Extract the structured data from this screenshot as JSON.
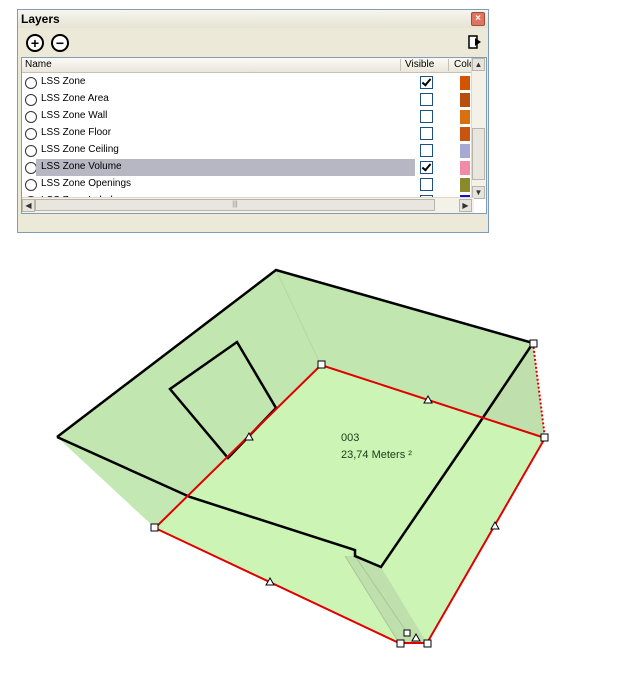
{
  "panel": {
    "title": "Layers",
    "close_glyph": "×",
    "add_glyph": "+",
    "remove_glyph": "−",
    "columns": {
      "name": "Name",
      "visible": "Visible",
      "color": "Colo"
    },
    "rows": [
      {
        "name": "LSS Zone",
        "visible": true,
        "color": "#d35400",
        "selected": false
      },
      {
        "name": "LSS Zone Area",
        "visible": false,
        "color": "#b94d0e",
        "selected": false
      },
      {
        "name": "LSS Zone Wall",
        "visible": false,
        "color": "#d9700f",
        "selected": false
      },
      {
        "name": "LSS Zone Floor",
        "visible": false,
        "color": "#c9530f",
        "selected": false
      },
      {
        "name": "LSS Zone Ceiling",
        "visible": false,
        "color": "#a6a9d2",
        "selected": false
      },
      {
        "name": "LSS Zone Volume",
        "visible": true,
        "color": "#f08ca8",
        "selected": true
      },
      {
        "name": "LSS Zone Openings",
        "visible": false,
        "color": "#8a8a2a",
        "selected": false
      },
      {
        "name": "LSS Zone Label",
        "visible": true,
        "color": "#1010d0",
        "selected": false
      }
    ]
  },
  "zone": {
    "number": "003",
    "area": "23,74 Meters ²"
  },
  "colors": {
    "fill_light": "#ccf5b5",
    "fill_mid": "#c4e8b4",
    "fill_dark": "#bfe0ad",
    "edge": "#000000",
    "selection": "#e00000"
  }
}
